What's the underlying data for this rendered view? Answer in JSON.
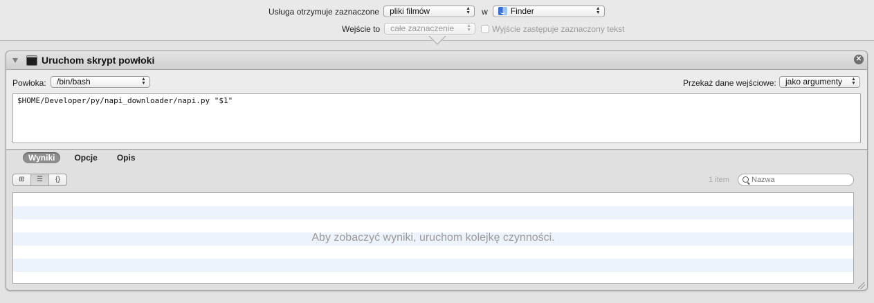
{
  "workflow": {
    "receives_label": "Usługa otrzymuje zaznaczone",
    "receives_value": "pliki filmów",
    "in_label": "w",
    "app_value": "Finder",
    "input_label": "Wejście to",
    "input_value": "całe zaznaczenie",
    "replaces_label": "Wyjście zastępuje zaznaczony tekst"
  },
  "action": {
    "title": "Uruchom skrypt powłoki",
    "shell_label": "Powłoka:",
    "shell_value": "/bin/bash",
    "pass_input_label": "Przekaż dane wejściowe:",
    "pass_input_value": "jako argumenty",
    "script": "$HOME/Developer/py/napi_downloader/napi.py \"$1\""
  },
  "results": {
    "tabs": [
      {
        "label": "Wyniki",
        "active": true
      },
      {
        "label": "Opcje",
        "active": false
      },
      {
        "label": "Opis",
        "active": false
      }
    ],
    "view_icons": [
      "grid-view-icon",
      "list-view-icon",
      "code-view-icon"
    ],
    "item_count": "1 item",
    "search_placeholder": "Nazwa",
    "empty_message": "Aby zobaczyć wyniki, uruchom kolejkę czynności."
  }
}
